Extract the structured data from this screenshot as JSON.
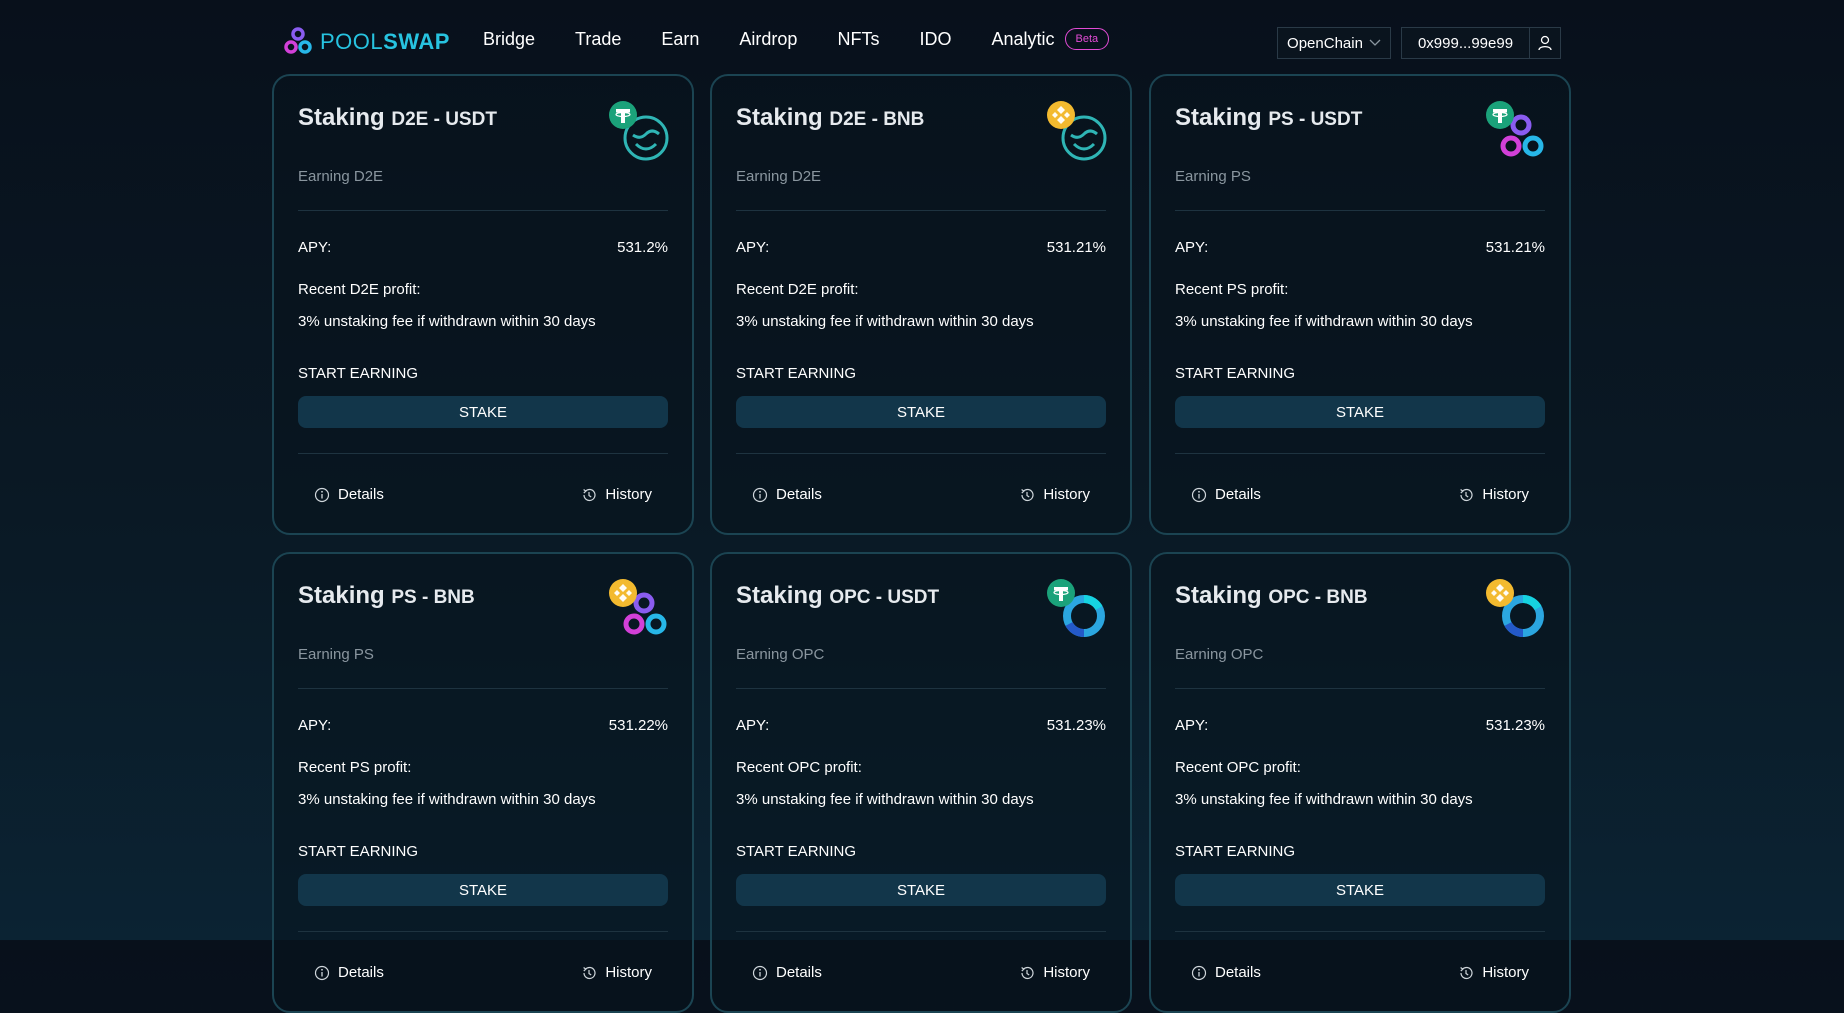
{
  "header": {
    "logo": {
      "pool": "POOL",
      "swap": "SWAP"
    },
    "nav": [
      {
        "label": "Bridge"
      },
      {
        "label": "Trade"
      },
      {
        "label": "Earn"
      },
      {
        "label": "Airdrop"
      },
      {
        "label": "NFTs"
      },
      {
        "label": "IDO"
      },
      {
        "label": "Analytic"
      }
    ],
    "beta_badge": "Beta",
    "chain": "OpenChain",
    "wallet_address": "0x999...99e99"
  },
  "cards": [
    {
      "title": "Staking",
      "pair": "D2E - USDT",
      "earning": "Earning D2E",
      "apy_label": "APY:",
      "apy": "531.2%",
      "profit_label": "Recent D2E profit:",
      "fee_note": "3% unstaking fee if withdrawn within 30 days",
      "start_label": "START EARNING",
      "stake_label": "STAKE",
      "details_label": "Details",
      "history_label": "History",
      "icon": {
        "token": "usdt",
        "pool": "d2e"
      }
    },
    {
      "title": "Staking",
      "pair": "D2E - BNB",
      "earning": "Earning D2E",
      "apy_label": "APY:",
      "apy": "531.21%",
      "profit_label": "Recent D2E profit:",
      "fee_note": "3% unstaking fee if withdrawn within 30 days",
      "start_label": "START EARNING",
      "stake_label": "STAKE",
      "details_label": "Details",
      "history_label": "History",
      "icon": {
        "token": "bnb",
        "pool": "d2e"
      }
    },
    {
      "title": "Staking",
      "pair": "PS - USDT",
      "earning": "Earning PS",
      "apy_label": "APY:",
      "apy": "531.21%",
      "profit_label": "Recent PS profit:",
      "fee_note": "3% unstaking fee if withdrawn within 30 days",
      "start_label": "START EARNING",
      "stake_label": "STAKE",
      "details_label": "Details",
      "history_label": "History",
      "icon": {
        "token": "usdt",
        "pool": "ps"
      }
    },
    {
      "title": "Staking",
      "pair": "PS - BNB",
      "earning": "Earning PS",
      "apy_label": "APY:",
      "apy": "531.22%",
      "profit_label": "Recent PS profit:",
      "fee_note": "3% unstaking fee if withdrawn within 30 days",
      "start_label": "START EARNING",
      "stake_label": "STAKE",
      "details_label": "Details",
      "history_label": "History",
      "icon": {
        "token": "bnb",
        "pool": "ps"
      }
    },
    {
      "title": "Staking",
      "pair": "OPC - USDT",
      "earning": "Earning OPC",
      "apy_label": "APY:",
      "apy": "531.23%",
      "profit_label": "Recent OPC profit:",
      "fee_note": "3% unstaking fee if withdrawn within 30 days",
      "start_label": "START EARNING",
      "stake_label": "STAKE",
      "details_label": "Details",
      "history_label": "History",
      "icon": {
        "token": "usdt",
        "pool": "opc"
      }
    },
    {
      "title": "Staking",
      "pair": "OPC - BNB",
      "earning": "Earning OPC",
      "apy_label": "APY:",
      "apy": "531.23%",
      "profit_label": "Recent OPC profit:",
      "fee_note": "3% unstaking fee if withdrawn within 30 days",
      "start_label": "START EARNING",
      "stake_label": "STAKE",
      "details_label": "Details",
      "history_label": "History",
      "icon": {
        "token": "bnb",
        "pool": "opc"
      }
    }
  ],
  "colors": {
    "accent": "#27c3e0",
    "beta": "#e24bd6",
    "stake_button": "#12364a",
    "card_border": "#1b4452",
    "usdt": "#1ba27a",
    "bnb": "#f3ba2f"
  }
}
